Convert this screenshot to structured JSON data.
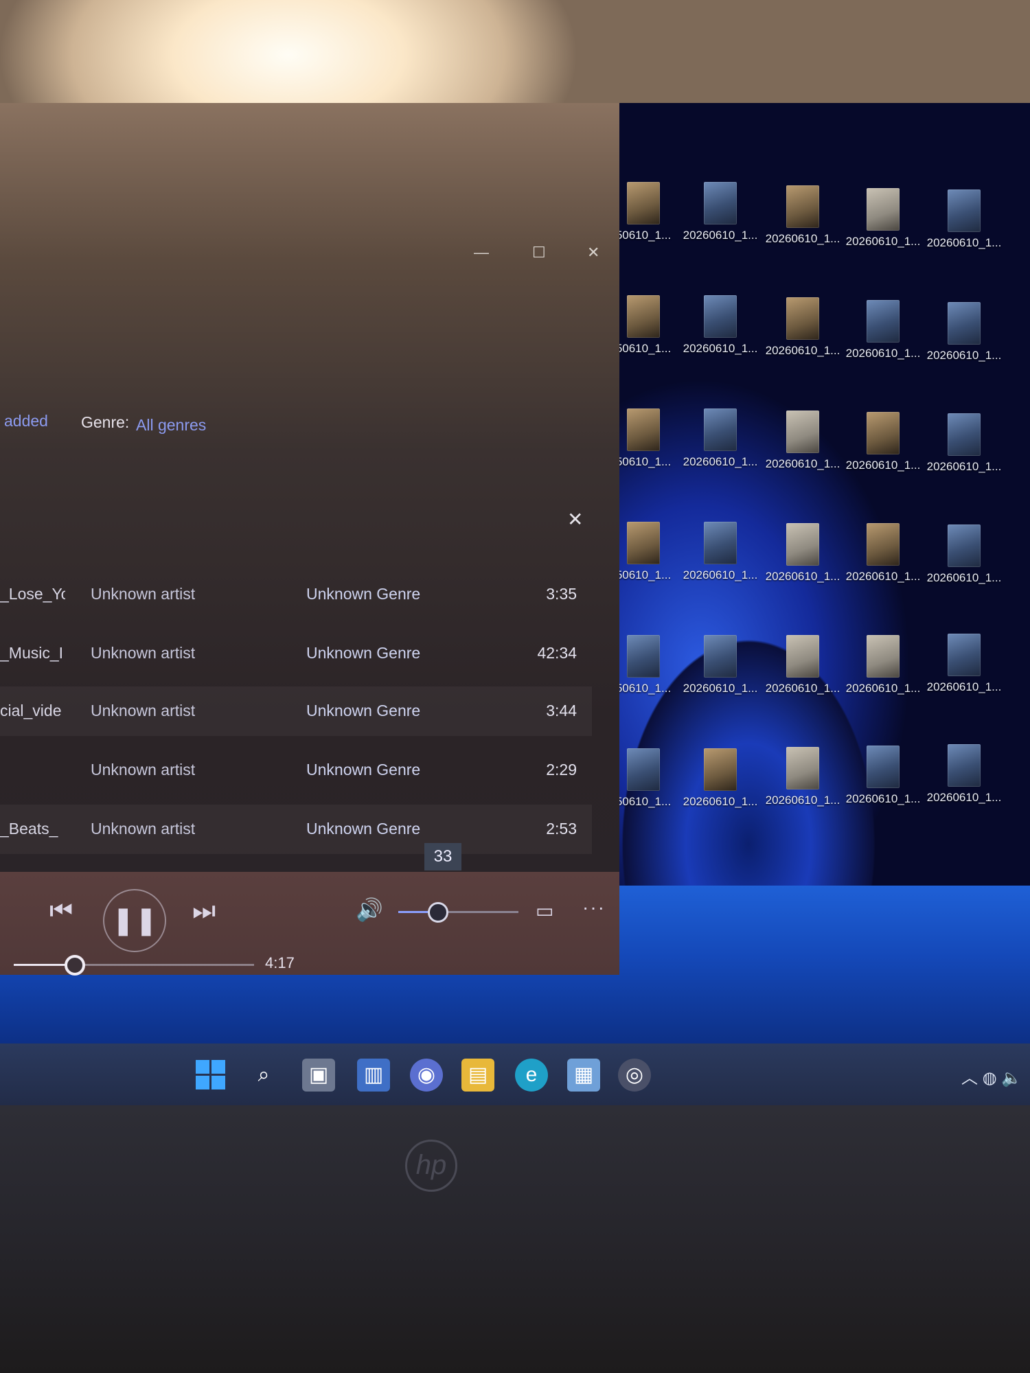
{
  "player": {
    "filters": {
      "sort_tail": "added",
      "genre_label": "Genre:",
      "genre_value": "All genres"
    },
    "tracks": [
      {
        "title": "_Lose_Yo",
        "artist": "Unknown artist",
        "genre": "Unknown Genre",
        "duration": "3:35"
      },
      {
        "title": "_Music_I",
        "artist": "Unknown artist",
        "genre": "Unknown Genre",
        "duration": "42:34"
      },
      {
        "title": "cial_vide",
        "artist": "Unknown artist",
        "genre": "Unknown Genre",
        "duration": "3:44"
      },
      {
        "title": "",
        "artist": "Unknown artist",
        "genre": "Unknown Genre",
        "duration": "2:29"
      },
      {
        "title": "_Beats_",
        "artist": "Unknown artist",
        "genre": "Unknown Genre",
        "duration": "2:53"
      }
    ],
    "playback": {
      "volume": 33,
      "volume_tooltip": "33",
      "total_time": "4:17",
      "progress_fraction": 0.25
    }
  },
  "desktop": {
    "icon_label": "20260610_1...",
    "icon_label_clipped": "50610_1..."
  },
  "colors": {
    "accent": "#8ba0ff",
    "wallpaper_blue": "#1f60d6"
  },
  "taskbar": {
    "icons": [
      "start-icon",
      "search-icon",
      "task-view-icon",
      "widgets-icon",
      "chat-icon",
      "file-explorer-icon",
      "edge-icon",
      "store-icon",
      "media-player-icon"
    ]
  }
}
